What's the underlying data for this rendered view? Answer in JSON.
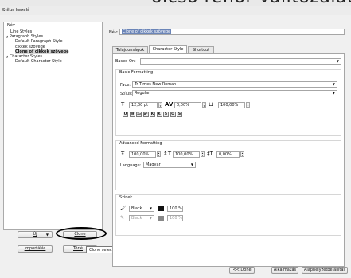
{
  "window": {
    "title": "Stílus kezelő"
  },
  "background": {
    "overlay_text": "olcső reflor válitozálat is"
  },
  "tree": {
    "header": "Név",
    "items": [
      {
        "label": "Line Styles",
        "indent": 1,
        "toggle": "",
        "selected": false
      },
      {
        "label": "Paragraph Styles",
        "indent": 0,
        "toggle": "◢",
        "selected": false
      },
      {
        "label": "Default Paragraph Style",
        "indent": 2,
        "toggle": "",
        "selected": false
      },
      {
        "label": "cikkek szövege",
        "indent": 2,
        "toggle": "",
        "selected": false
      },
      {
        "label": "Clone of cikkek szövege",
        "indent": 2,
        "toggle": "",
        "selected": true
      },
      {
        "label": "Character Styles",
        "indent": 0,
        "toggle": "◢",
        "selected": false
      },
      {
        "label": "Default Character Style",
        "indent": 2,
        "toggle": "",
        "selected": false
      }
    ]
  },
  "left_buttons": {
    "new": "Új",
    "clone": "Clone",
    "import": "Importálás",
    "delete": "Törlé"
  },
  "tooltip": "Clone selected style",
  "name_field": {
    "label": "Név:",
    "value": "Clone of cikkek szövege"
  },
  "tabs": [
    {
      "label": "Tulajdonságok",
      "active": false
    },
    {
      "label": "Character Style",
      "active": true
    },
    {
      "label": "Shortcut",
      "active": false
    }
  ],
  "based_on": {
    "label": "Based On:",
    "value": ""
  },
  "basic_formatting": {
    "title": "Basic Formatting",
    "face_label": "Face:",
    "face_value": "Tr Times New Roman",
    "style_label": "Stílus:",
    "style_value": "Regular",
    "size": "12,00 pt",
    "tracking": "0,00%",
    "scale_width": "100,00%",
    "effects": [
      "U",
      "W",
      "x₂",
      "x²",
      "K",
      "K",
      "S",
      "O",
      "S"
    ]
  },
  "advanced_formatting": {
    "title": "Advanced Formatting",
    "scale_v": "100,00%",
    "scale_h": "100,00%",
    "baseline": "0,00%",
    "language_label": "Language:",
    "language_value": "Magyar"
  },
  "colors": {
    "title": "Színek",
    "fill_color": "Black",
    "fill_shade": "100 %",
    "stroke_color": "Black",
    "stroke_shade": "100 %"
  },
  "bottom_buttons": {
    "back": "<< Done",
    "apply": "Alkalmazás",
    "reset": "Alaphelyzetbe állítás"
  }
}
